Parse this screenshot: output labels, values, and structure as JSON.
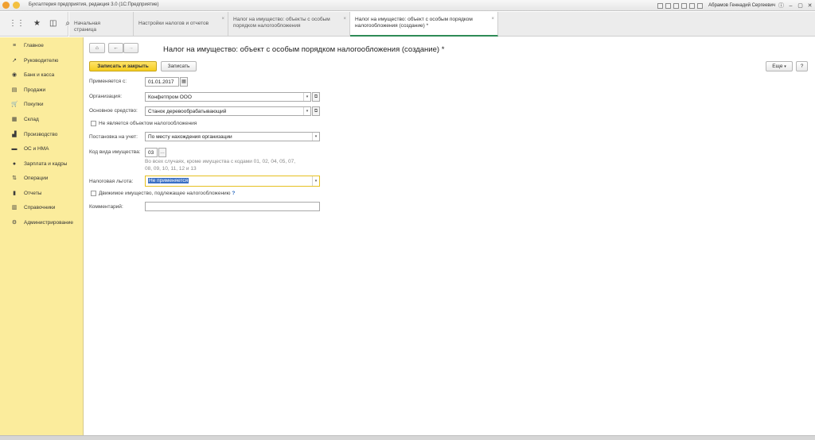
{
  "window": {
    "title": "Бухгалтерия предприятия, редакция 3.0  (1С:Предприятие)",
    "user": "Абрамов Геннадий Сергеевич",
    "icons": [
      "home-icon",
      "history-icon",
      "favorites-icon",
      "calculator-icon",
      "calendar-icon",
      "notifications-icon"
    ]
  },
  "tabs": [
    {
      "label": "Начальная страница"
    },
    {
      "label": "Настройки налогов и отчетов"
    },
    {
      "label": "Налог на имущество: объекты с особым порядком налогообложения"
    },
    {
      "label": "Налог на имущество: объект с особым порядком налогообложения (создание) *"
    }
  ],
  "sidebar": {
    "items": [
      {
        "label": "Главное",
        "icon": "≡"
      },
      {
        "label": "Руководителю",
        "icon": "↗"
      },
      {
        "label": "Банк и касса",
        "icon": "◉"
      },
      {
        "label": "Продажи",
        "icon": "▤"
      },
      {
        "label": "Покупки",
        "icon": "🛒"
      },
      {
        "label": "Склад",
        "icon": "▦"
      },
      {
        "label": "Производство",
        "icon": "▟"
      },
      {
        "label": "ОС и НМА",
        "icon": "▬"
      },
      {
        "label": "Зарплата и кадры",
        "icon": "●"
      },
      {
        "label": "Операции",
        "icon": "⇅"
      },
      {
        "label": "Отчеты",
        "icon": "▮"
      },
      {
        "label": "Справочники",
        "icon": "▥"
      },
      {
        "label": "Администрирование",
        "icon": "⚙"
      }
    ]
  },
  "form": {
    "title": "Налог на имущество: объект с особым порядком налогообложения (создание) *",
    "save_close": "Записать и закрыть",
    "save": "Записать",
    "more": "Еще",
    "help": "?",
    "applies_label": "Применяется с:",
    "applies_value": "01.01.2017",
    "org_label": "Организация:",
    "org_value": "Конфетпром ООО",
    "asset_label": "Основное средство:",
    "asset_value": "Станок деревообрабатывающий",
    "not_taxable_label": "Не является объектом налогообложения",
    "registration_label": "Постановка на учет:",
    "registration_value": "По месту нахождения организации",
    "code_label": "Код вида имущества:",
    "code_value": "03",
    "code_hint": "Во всех случаях, кроме имущества с кодами 01, 02, 04, 05, 07, 08, 09, 10, 11, 12 и 13",
    "benefit_label": "Налоговая льгота:",
    "benefit_value": "Не применяется",
    "movable_label": "Движимое имущество, подлежащее налогообложению",
    "movable_help": "?",
    "comment_label": "Комментарий:",
    "comment_value": ""
  }
}
